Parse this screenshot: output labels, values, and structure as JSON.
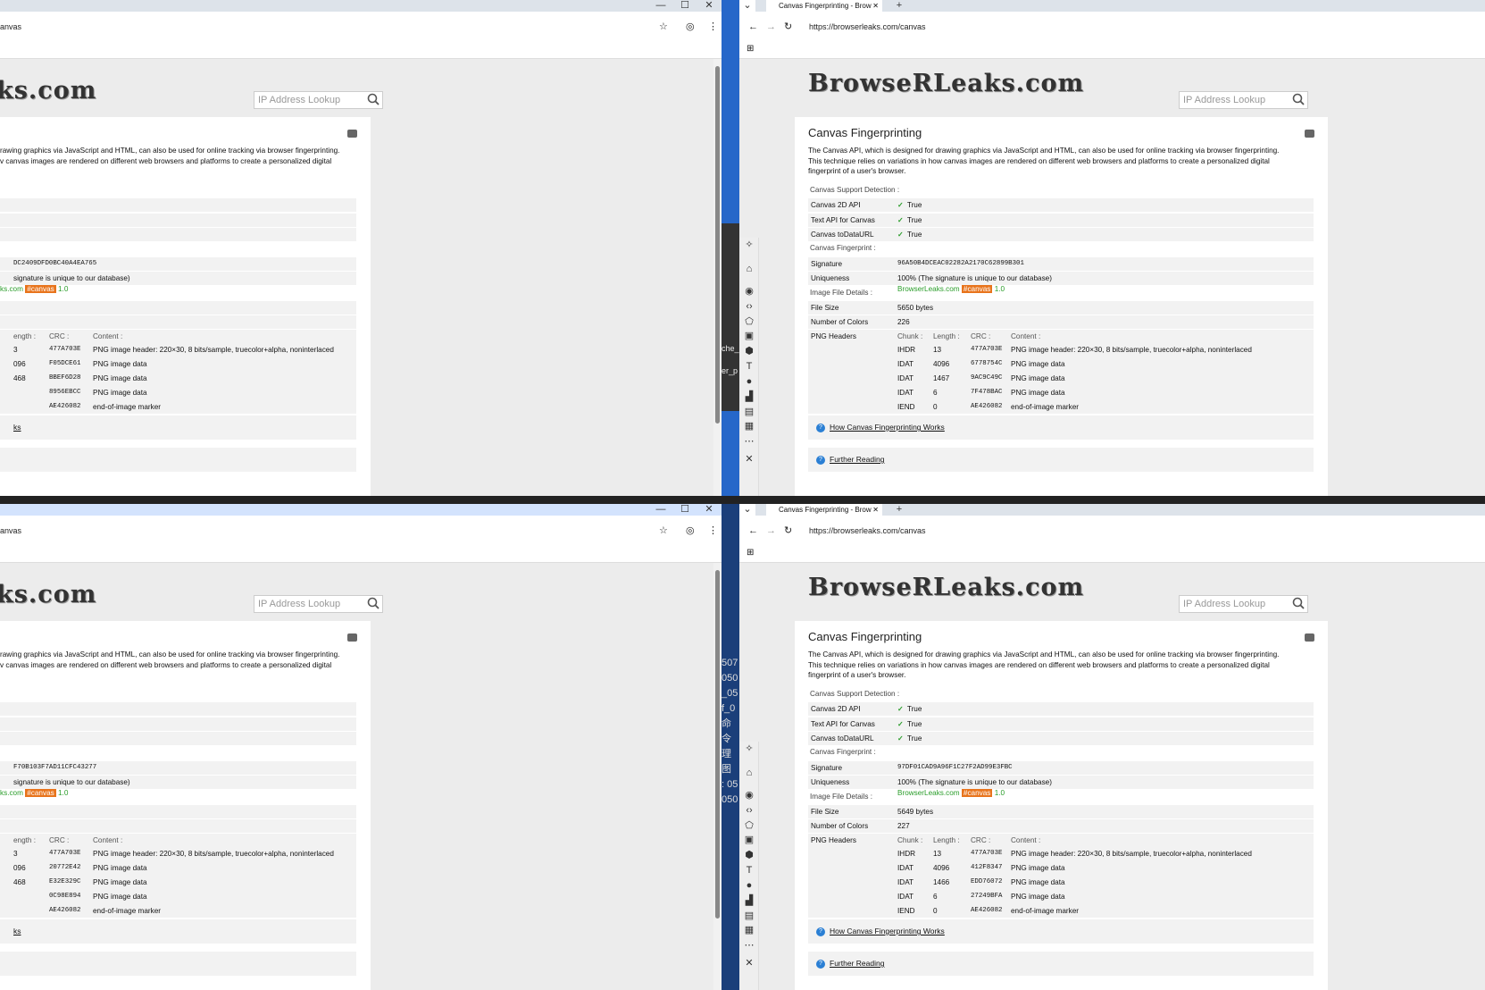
{
  "browser": {
    "tab_title": "Canvas Fingerprinting - Brow",
    "new_tab": "+",
    "url_full": "https://browserleaks.com/canvas",
    "url_cropped": "anvas",
    "min": "—",
    "max": "☐",
    "close": "✕",
    "logo_text": "BrowseRLeaks.com",
    "logo_cropped": "ks.com"
  },
  "page": {
    "search_placeholder": "IP Address Lookup",
    "title": "Canvas Fingerprinting",
    "desc_full": "The Canvas API, which is designed for drawing graphics via JavaScript and HTML, can also be used for online tracking via browser fingerprinting. This technique relies on variations in how canvas images are rendered on different web browsers and platforms to create a personalized digital fingerprint of a user's browser.",
    "desc_l1_cropped": "rawing graphics via JavaScript and HTML, can also be used for online tracking via browser fingerprinting.",
    "desc_l2_cropped": "v canvas images are rendered on different web browsers and platforms to create a personalized digital",
    "support_header": "Canvas Support Detection :",
    "support": [
      {
        "k": "Canvas 2D API",
        "v": "True"
      },
      {
        "k": "Text API for Canvas",
        "v": "True"
      },
      {
        "k": "Canvas toDataURL",
        "v": "True"
      }
    ],
    "fp_header": "Canvas Fingerprint :",
    "sig_label": "Signature",
    "uniq_label": "Uniqueness",
    "uniq_value": "100% (The signature is unique to our database)",
    "uniq_cropped": "signature is unique to our database)",
    "img_header": "Image File Details :",
    "img_site": "BrowserLeaks.com",
    "img_site_cropped": "ks.com",
    "img_tag": "#canvas",
    "img_ver": "1.0",
    "filesize_label": "File Size",
    "colors_label": "Number of Colors",
    "png_label": "PNG Headers",
    "h_chunk": "Chunk :",
    "h_length": "Length :",
    "h_crc": "CRC :",
    "h_content": "Content :",
    "h_length_cropped": "ength :",
    "link1": "How Canvas Fingerprinting Works",
    "link1_cropped": "ks",
    "link2": "Further Reading"
  },
  "instances": {
    "tl": {
      "signature_cropped": "DC2409DFD0BC40A4EA765",
      "crcs": [
        "477A703E",
        "F05DCE61",
        "BBEF6D28",
        "8956EBCC",
        "AE426082"
      ],
      "lengths_cropped": [
        "3",
        "096",
        "468",
        "",
        ""
      ]
    },
    "tr": {
      "signature": "96A50B4DCEAC02282A2170C62899B301",
      "file_size": "5650 bytes",
      "colors": "226",
      "lengths": [
        "13",
        "4096",
        "1467",
        "6",
        "0"
      ],
      "crcs": [
        "477A703E",
        "6778754C",
        "9AC9C49C",
        "7F478BAC",
        "AE426082"
      ]
    },
    "bl": {
      "signature_cropped": "F70B103F7AD11CFC43277",
      "crcs": [
        "477A703E",
        "20772E42",
        "E32E329C",
        "0C98E894",
        "AE426082"
      ],
      "lengths_cropped": [
        "3",
        "096",
        "468",
        "",
        ""
      ]
    },
    "br": {
      "signature": "97DF01CAD9A96F1C27F2AD99E3FBC",
      "file_size": "5649 bytes",
      "colors": "227",
      "lengths": [
        "13",
        "4096",
        "1466",
        "6",
        "0"
      ],
      "crcs": [
        "477A703E",
        "412F8347",
        "EDD76072",
        "27249BFA",
        "AE426082"
      ]
    }
  },
  "png_chunks": [
    "IHDR",
    "IDAT",
    "IDAT",
    "IDAT",
    "IEND"
  ],
  "png_contents": [
    "PNG image header: 220×30, 8 bits/sample, truecolor+alpha, noninterlaced",
    "PNG image data",
    "PNG image data",
    "PNG image data",
    "end-of-image marker"
  ],
  "desktop": {
    "left_text": [
      "che_",
      "er_p"
    ],
    "left_text2": [
      "507",
      "050",
      "_05",
      "f_0",
      "命令",
      "理图",
      ": 05",
      "050"
    ]
  }
}
